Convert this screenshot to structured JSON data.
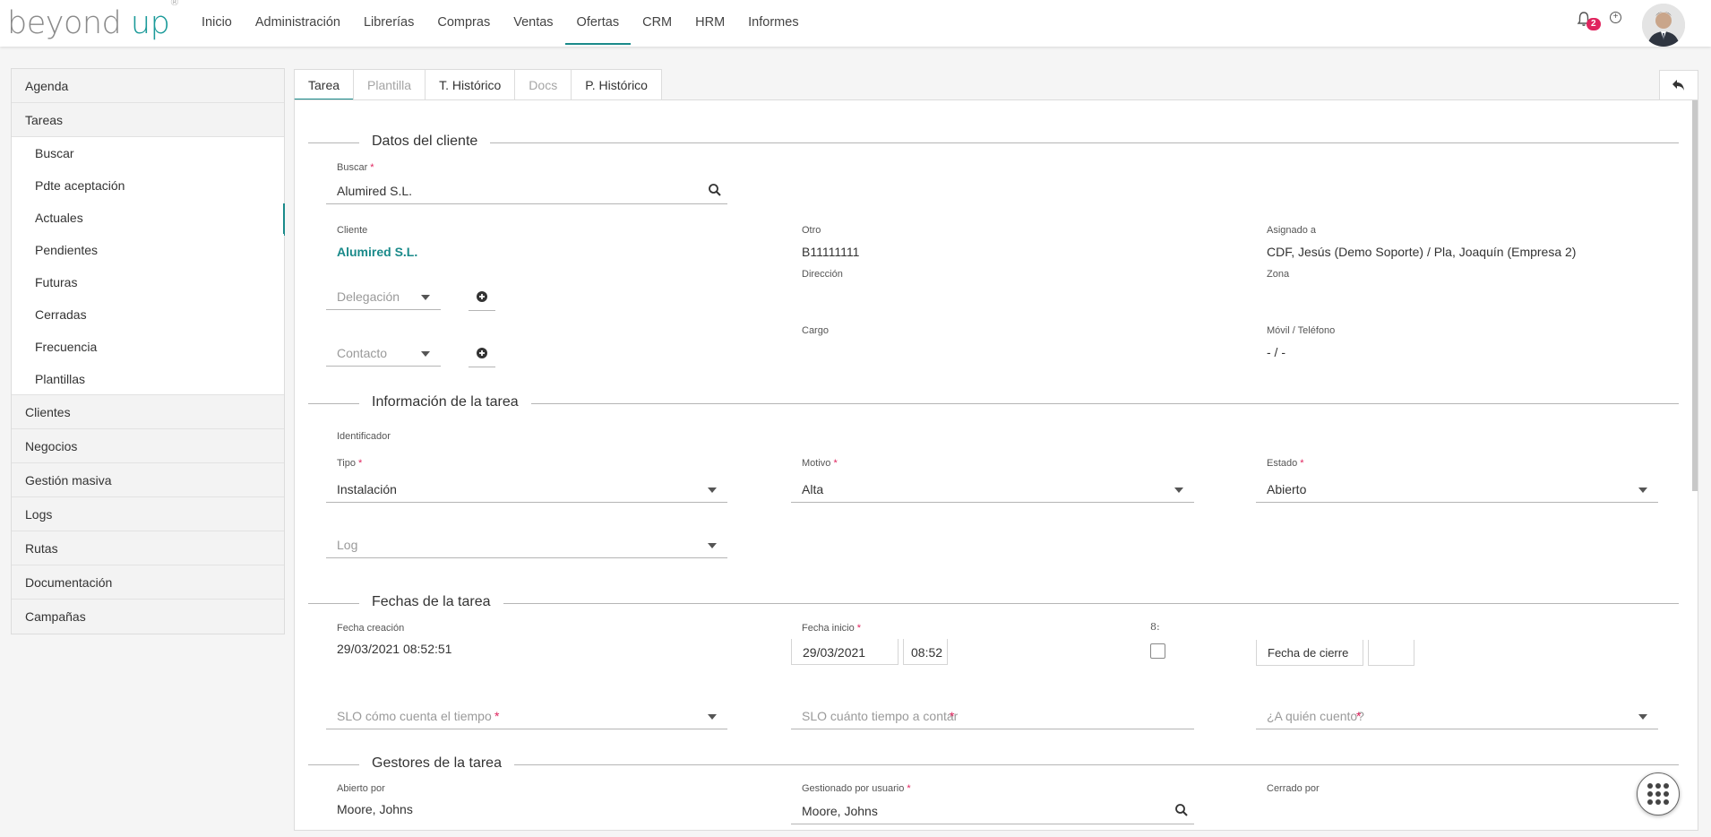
{
  "brand": {
    "name_part1": "beyond",
    "name_part2": "up",
    "mark": "®"
  },
  "nav": [
    "Inicio",
    "Administración",
    "Librerías",
    "Compras",
    "Ventas",
    "Ofertas",
    "CRM",
    "HRM",
    "Informes"
  ],
  "nav_active": "Ofertas",
  "notifications": {
    "count": "2"
  },
  "sidebar": {
    "top": [
      "Agenda",
      "Tareas"
    ],
    "tareas_sub": [
      "Buscar",
      "Pdte aceptación",
      "Actuales",
      "Pendientes",
      "Futuras",
      "Cerradas",
      "Frecuencia",
      "Plantillas"
    ],
    "bottom": [
      "Clientes",
      "Negocios",
      "Gestión masiva",
      "Logs",
      "Rutas",
      "Documentación",
      "Campañas"
    ],
    "active_sub": "Actuales"
  },
  "tabs": [
    {
      "label": "Tarea",
      "state": "active"
    },
    {
      "label": "Plantilla",
      "state": "disabled"
    },
    {
      "label": "T. Histórico",
      "state": "normal"
    },
    {
      "label": "Docs",
      "state": "disabled"
    },
    {
      "label": "P. Histórico",
      "state": "normal"
    }
  ],
  "sections": {
    "cliente": "Datos del cliente",
    "info": "Información de la tarea",
    "fechas": "Fechas de la tarea",
    "gestores": "Gestores de la tarea"
  },
  "cliente": {
    "buscar_label": "Buscar",
    "buscar_value": "Alumired S.L.",
    "cliente_label": "Cliente",
    "cliente_value": "Alumired S.L.",
    "otro_label": "Otro",
    "otro_value": "B11111111",
    "asignado_label": "Asignado a",
    "asignado_value": "CDF, Jesús (Demo Soporte) / Pla, Joaquín (Empresa 2)",
    "delegacion_placeholder": "Delegación",
    "direccion_label": "Dirección",
    "zona_label": "Zona",
    "contacto_placeholder": "Contacto",
    "cargo_label": "Cargo",
    "movil_label": "Móvil / Teléfono",
    "movil_value": "- / -"
  },
  "info": {
    "identificador_label": "Identificador",
    "tipo_label": "Tipo",
    "tipo_value": "Instalación",
    "motivo_label": "Motivo",
    "motivo_value": "Alta",
    "estado_label": "Estado",
    "estado_value": "Abierto",
    "log_placeholder": "Log"
  },
  "fechas": {
    "creacion_label": "Fecha creación",
    "creacion_value": "29/03/2021 08:52:51",
    "inicio_label": "Fecha inicio",
    "inicio_date": "29/03/2021",
    "inicio_time": "08:52",
    "check_label": "8:",
    "cierre_placeholder": "Fecha de cierre",
    "slo_como_placeholder": "SLO cómo cuenta el tiempo",
    "slo_cuanto_placeholder": "SLO cuánto tiempo a contar",
    "quien_placeholder": "¿A quién cuento?"
  },
  "gestores": {
    "abierto_label": "Abierto por",
    "abierto_value": "Moore, Johns",
    "gestionado_label": "Gestionado por usuario",
    "gestionado_value": "Moore, Johns",
    "cerrado_label": "Cerrado por"
  },
  "colors": {
    "accent": "#1a8a8a",
    "required": "#e0245e",
    "badge": "#e0245e"
  },
  "icons": [
    "bell-icon",
    "plus-circle-icon",
    "search-icon",
    "plus-icon",
    "back-arrow-icon",
    "grid-menu-icon",
    "chevron-down-icon"
  ]
}
